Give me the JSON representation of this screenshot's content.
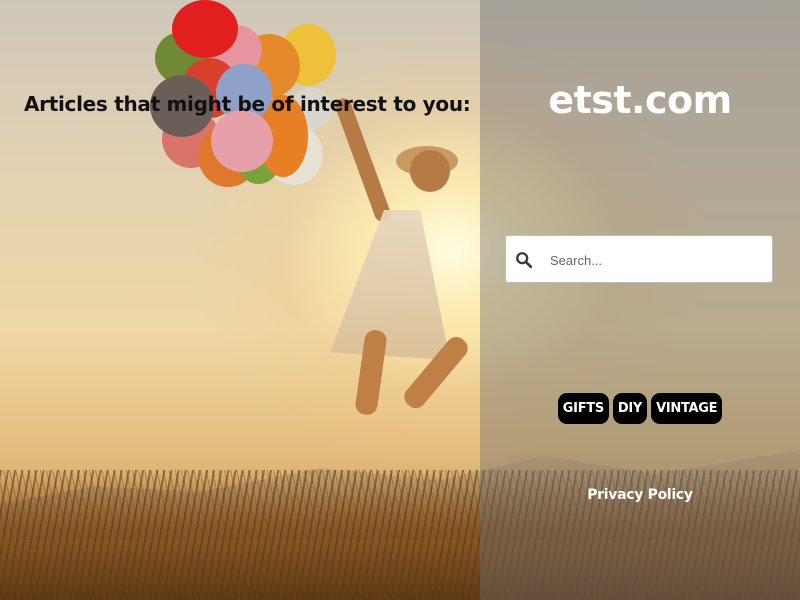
{
  "left": {
    "heading": "Articles that might be of interest to you:"
  },
  "right": {
    "site_title": "etst.com",
    "search": {
      "placeholder": "Search...",
      "value": "",
      "icon": "search-icon"
    },
    "tags": [
      {
        "label": "GIFTS"
      },
      {
        "label": "DIY"
      },
      {
        "label": "VINTAGE"
      }
    ],
    "privacy_label": "Privacy Policy"
  },
  "colors": {
    "tag_background": "#000000",
    "title_text": "#ffffff",
    "heading_text": "#111111"
  }
}
